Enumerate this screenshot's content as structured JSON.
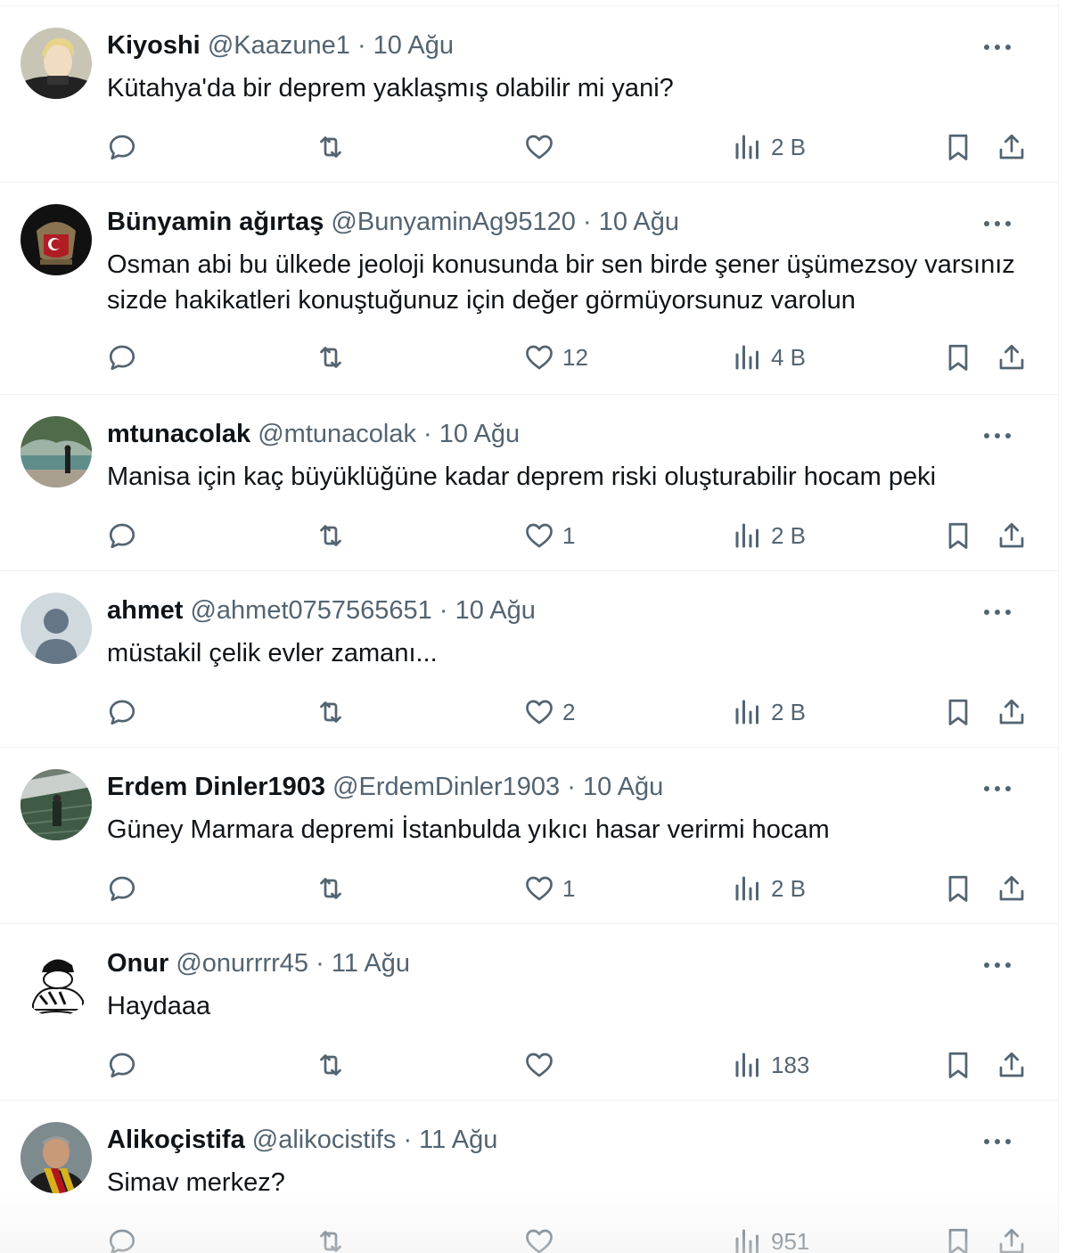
{
  "tweets": [
    {
      "name": "Kiyoshi",
      "handle": "@Kaazune1",
      "date": "10 Ağu",
      "text": "Kütahya'da bir deprem yaklaşmış olabilir mi yani?",
      "replies": "",
      "retweets": "",
      "likes": "",
      "views": "2 B",
      "avatar": "avatar-anime-man"
    },
    {
      "name": "Bünyamin ağırtaş",
      "handle": "@BunyaminAg95120",
      "date": "10 Ağu",
      "text": "Osman abi bu ülkede jeoloji konusunda bir sen birde şener üşümezsoy varsınız sizde hakikatleri konuştuğunuz için değer görmüyorsunuz varolun",
      "replies": "",
      "retweets": "",
      "likes": "12",
      "views": "4 B",
      "avatar": "avatar-crest"
    },
    {
      "name": "mtunacolak",
      "handle": "@mtunacolak",
      "date": "10 Ağu",
      "text": "Manisa için kaç büyüklüğüne kadar deprem riski oluşturabilir hocam peki",
      "replies": "",
      "retweets": "",
      "likes": "1",
      "views": "2 B",
      "avatar": "avatar-lake"
    },
    {
      "name": "ahmet",
      "handle": "@ahmet0757565651",
      "date": "10 Ağu",
      "text": "müstakil çelik evler zamanı...",
      "replies": "",
      "retweets": "",
      "likes": "2",
      "views": "2 B",
      "avatar": "avatar-default"
    },
    {
      "name": "Erdem Dinler1903",
      "handle": "@ErdemDinler1903",
      "date": "10 Ağu",
      "text": "Güney Marmara depremi İstanbulda yıkıcı hasar verirmi hocam",
      "replies": "",
      "retweets": "",
      "likes": "1",
      "views": "2 B",
      "avatar": "avatar-stadium"
    },
    {
      "name": "Onur",
      "handle": "@onurrrr45",
      "date": "11 Ağu",
      "text": "Haydaaa",
      "replies": "",
      "retweets": "",
      "likes": "",
      "views": "183",
      "avatar": "avatar-cartoon"
    },
    {
      "name": "Alikoçistifa",
      "handle": "@alikocistifs",
      "date": "11 Ağu",
      "text": "Simav merkez?",
      "replies": "",
      "retweets": "",
      "likes": "",
      "views": "951",
      "avatar": "avatar-scarf"
    }
  ],
  "colors": {
    "text": "#0f1419",
    "secondary": "#536471",
    "border": "#eff3f4"
  }
}
